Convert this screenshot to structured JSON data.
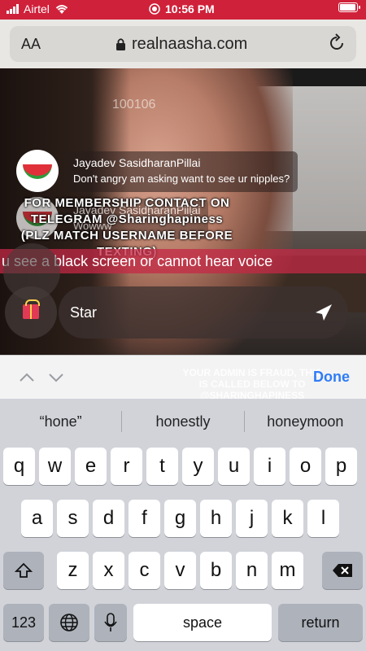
{
  "status_bar": {
    "carrier": "Airtel",
    "time": "10:56 PM"
  },
  "browser": {
    "text_size_label": "AA",
    "url": "realnaasha.com"
  },
  "stream": {
    "viewer_count": "100106",
    "chat": [
      {
        "name": "Jayadev SasidharanPillai",
        "message": "Don't angry am asking want to see ur nipples?"
      },
      {
        "name": "Jayadev SasidharanPillai",
        "message": "Wowww"
      }
    ],
    "overlay_lines": [
      "FOR MEMBERSHIP CONTACT ON",
      "TELEGRAM @Sharinghapiness",
      "(PLZ MATCH USERNAME BEFORE",
      "TEXTING)"
    ],
    "banner": "u see a black screen or cannot hear voice",
    "message_input_value": "Star"
  },
  "accessory": {
    "done_label": "Done",
    "ghost_lines": [
      "YOUR ADMIN IS FRAUD, THIS",
      "IS CALLED BELOW TO",
      "@SHARINGHAPINESS"
    ]
  },
  "keyboard": {
    "predictions": [
      "“hone”",
      "honestly",
      "honeymoon"
    ],
    "row1": [
      "q",
      "w",
      "e",
      "r",
      "t",
      "y",
      "u",
      "i",
      "o",
      "p"
    ],
    "row2": [
      "a",
      "s",
      "d",
      "f",
      "g",
      "h",
      "j",
      "k",
      "l"
    ],
    "row3": [
      "z",
      "x",
      "c",
      "v",
      "b",
      "n",
      "m"
    ],
    "numbers_label": "123",
    "space_label": "space",
    "return_label": "return"
  }
}
